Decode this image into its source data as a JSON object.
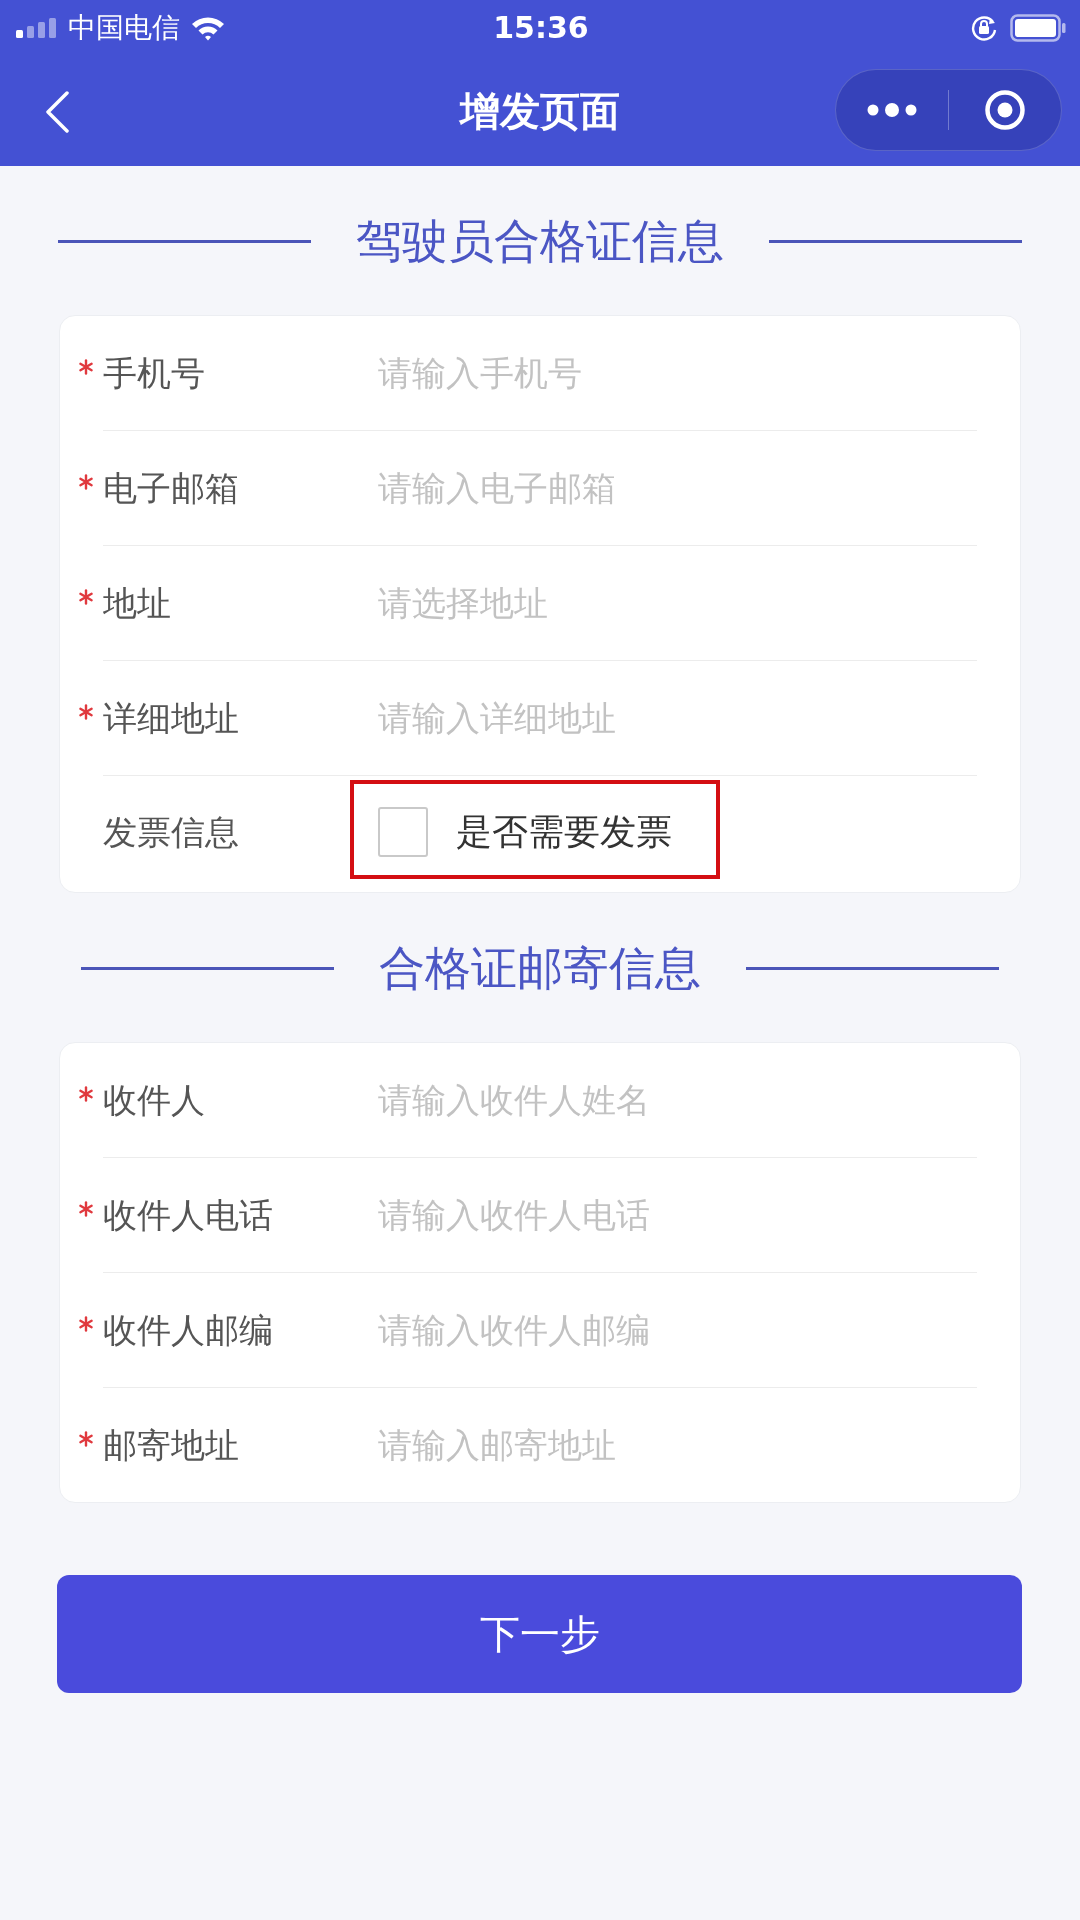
{
  "status_bar": {
    "carrier": "中国电信",
    "time": "15:36"
  },
  "nav_bar": {
    "title": "增发页面"
  },
  "sections": [
    {
      "title": "驾驶员合格证信息",
      "fields": [
        {
          "kind": "input",
          "required": true,
          "label": "手机号",
          "placeholder": "请输入手机号"
        },
        {
          "kind": "input",
          "required": true,
          "label": "电子邮箱",
          "placeholder": "请输入电子邮箱"
        },
        {
          "kind": "input",
          "required": true,
          "label": "地址",
          "placeholder": "请选择地址"
        },
        {
          "kind": "input",
          "required": true,
          "label": "详细地址",
          "placeholder": "请输入详细地址"
        },
        {
          "kind": "checkbox",
          "required": false,
          "label": "发票信息",
          "option": "是否需要发票",
          "checked": false,
          "highlighted": true
        }
      ]
    },
    {
      "title": "合格证邮寄信息",
      "fields": [
        {
          "kind": "input",
          "required": true,
          "label": "收件人",
          "placeholder": "请输入收件人姓名"
        },
        {
          "kind": "input",
          "required": true,
          "label": "收件人电话",
          "placeholder": "请输入收件人电话"
        },
        {
          "kind": "input",
          "required": true,
          "label": "收件人邮编",
          "placeholder": "请输入收件人邮编"
        },
        {
          "kind": "input",
          "required": true,
          "label": "邮寄地址",
          "placeholder": "请输入邮寄地址"
        }
      ]
    }
  ],
  "next_button": {
    "label": "下一步"
  }
}
